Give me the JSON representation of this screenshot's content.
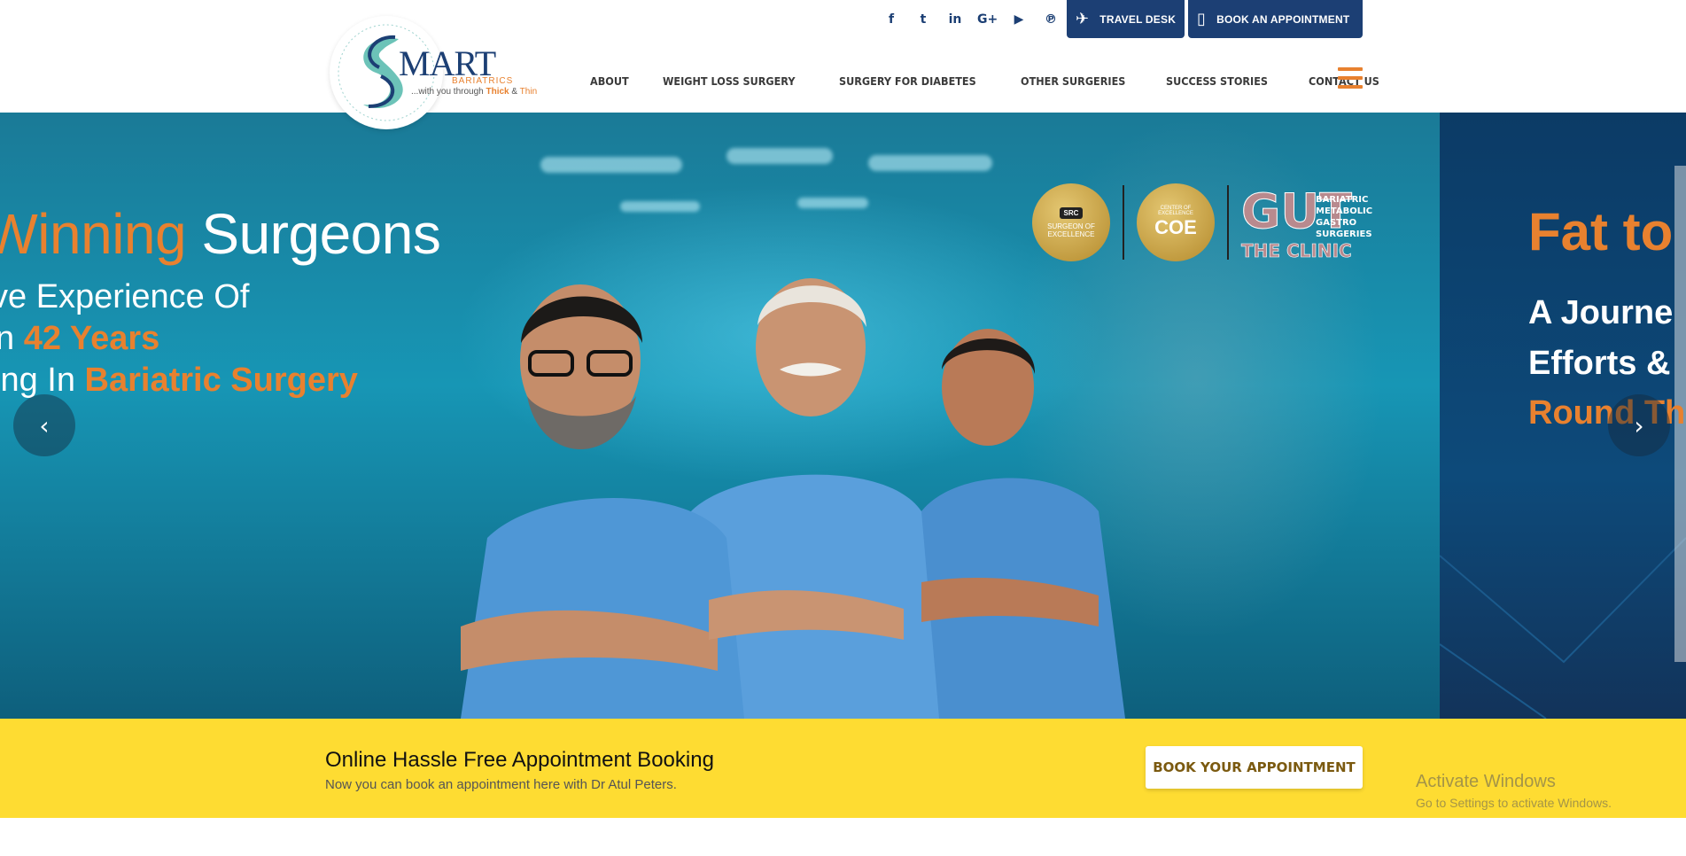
{
  "header": {
    "logo": {
      "name": "MART",
      "sub": "BARIATRICS",
      "tag_prefix": "...with you through ",
      "tag_thick": "Thick",
      "tag_and": " & ",
      "tag_thin": "Thin"
    },
    "social_icons": [
      "facebook-icon",
      "twitter-icon",
      "linkedin-icon",
      "google-plus-icon",
      "youtube-icon",
      "pinterest-icon"
    ],
    "travel_desk_label": "TRAVEL DESK",
    "book_appointment_label": "BOOK AN APPOINTMENT",
    "nav": [
      "ABOUT",
      "WEIGHT LOSS SURGERY",
      "SURGERY FOR DIABETES",
      "OTHER SURGERIES",
      "SUCCESS STORIES",
      "CONTACT US"
    ]
  },
  "hero": {
    "slide1": {
      "headline_orange": "d Winning",
      "headline_white": " Surgeons",
      "line1": "ve Experience Of",
      "line2_prefix": "n ",
      "line2_highlight": "42 Years",
      "line3_prefix": "ing In ",
      "line3_highlight": "Bariatric Surgery",
      "badge1_top": "SRC",
      "badge1_main": "SURGEON OF EXCELLENCE",
      "badge2_top": "CENTER OF EXCELLENCE",
      "badge2_main": "COE",
      "clinic_letters": "GUT",
      "clinic_lines": [
        "BARIATRIC",
        "METABOLIC",
        "GASTRO",
        "SURGERIES"
      ],
      "clinic_name": "THE CLINIC"
    },
    "slide2": {
      "headline": "Fat to",
      "line1": "A Journe",
      "line2": "Efforts &",
      "line3": "Round Th"
    },
    "prev_arrow": "‹",
    "next_arrow": "›"
  },
  "appointment": {
    "title": "Online Hassle Free Appointment Booking",
    "subtitle": "Now you can book an appointment here with Dr Atul Peters.",
    "button_label": "BOOK YOUR APPOINTMENT"
  },
  "watermark": {
    "line1": "Activate Windows",
    "line2": "Go to Settings to activate Windows."
  },
  "colors": {
    "brand_navy": "#1c3f74",
    "accent_orange": "#e8812f",
    "appt_yellow": "#fedc32"
  }
}
